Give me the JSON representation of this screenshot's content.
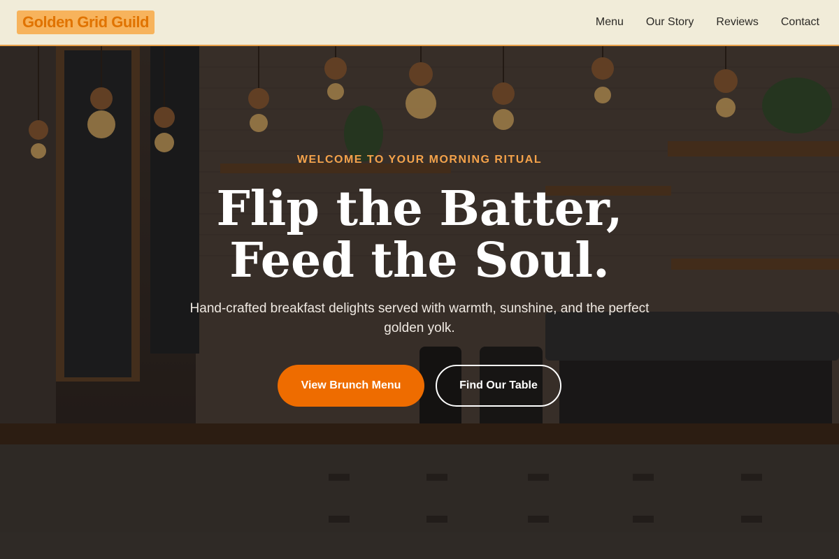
{
  "header": {
    "logo": "Golden Grid Guild",
    "nav": [
      "Menu",
      "Our Story",
      "Reviews",
      "Contact"
    ]
  },
  "hero": {
    "eyebrow": "WELCOME TO YOUR MORNING RITUAL",
    "title_line1": "Flip the Batter,",
    "title_line2": "Feed the Soul.",
    "subtitle": "Hand-crafted breakfast delights served with warmth, sunshine, and the perfect golden yolk.",
    "primary_button": "View Brunch Menu",
    "secondary_button": "Find Our Table"
  },
  "colors": {
    "accent": "#ee6c00",
    "eyebrow": "#f4a24a",
    "header_bg": "#f1ecd9"
  }
}
